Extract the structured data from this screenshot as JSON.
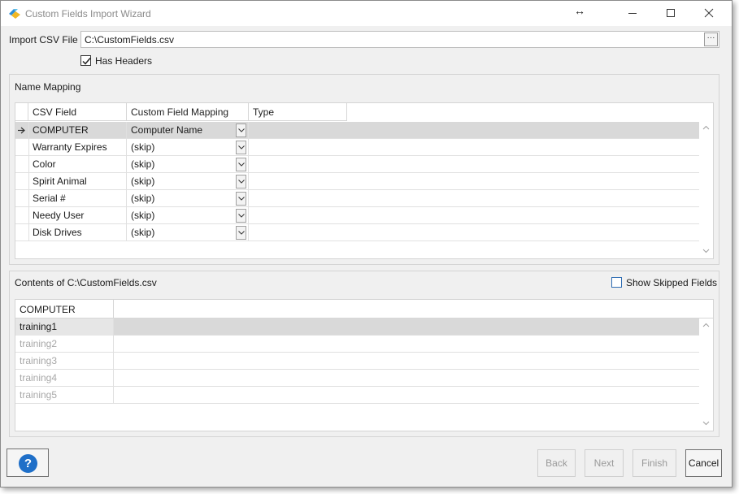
{
  "window": {
    "title": "Custom Fields Import Wizard"
  },
  "import": {
    "label": "Import CSV File",
    "file_path": "C:\\CustomFields.csv",
    "browse_label": "···",
    "has_headers_label": "Has Headers",
    "has_headers_checked": true
  },
  "name_mapping": {
    "group_label": "Name Mapping",
    "columns": [
      "CSV Field",
      "Custom Field Mapping",
      "Type"
    ],
    "rows": [
      {
        "field": "COMPUTER",
        "mapping": "Computer Name",
        "type": ""
      },
      {
        "field": "Warranty Expires",
        "mapping": "(skip)",
        "type": ""
      },
      {
        "field": "Color",
        "mapping": "(skip)",
        "type": ""
      },
      {
        "field": "Spirit Animal",
        "mapping": "(skip)",
        "type": ""
      },
      {
        "field": "Serial #",
        "mapping": "(skip)",
        "type": ""
      },
      {
        "field": "Needy User",
        "mapping": "(skip)",
        "type": ""
      },
      {
        "field": "Disk Drives",
        "mapping": "(skip)",
        "type": ""
      }
    ]
  },
  "contents": {
    "group_label": "Contents of C:\\CustomFields.csv",
    "show_skipped_label": "Show Skipped Fields",
    "show_skipped_checked": false,
    "columns": [
      "COMPUTER"
    ],
    "rows": [
      "training1",
      "training2",
      "training3",
      "training4",
      "training5"
    ]
  },
  "footer": {
    "help_label": "?",
    "back_label": "Back",
    "next_label": "Next",
    "finish_label": "Finish",
    "cancel_label": "Cancel"
  },
  "colors": {
    "accent": "#1f6fc8",
    "selected_row": "#d9d9d9",
    "window_bg": "#f0f0f0"
  }
}
